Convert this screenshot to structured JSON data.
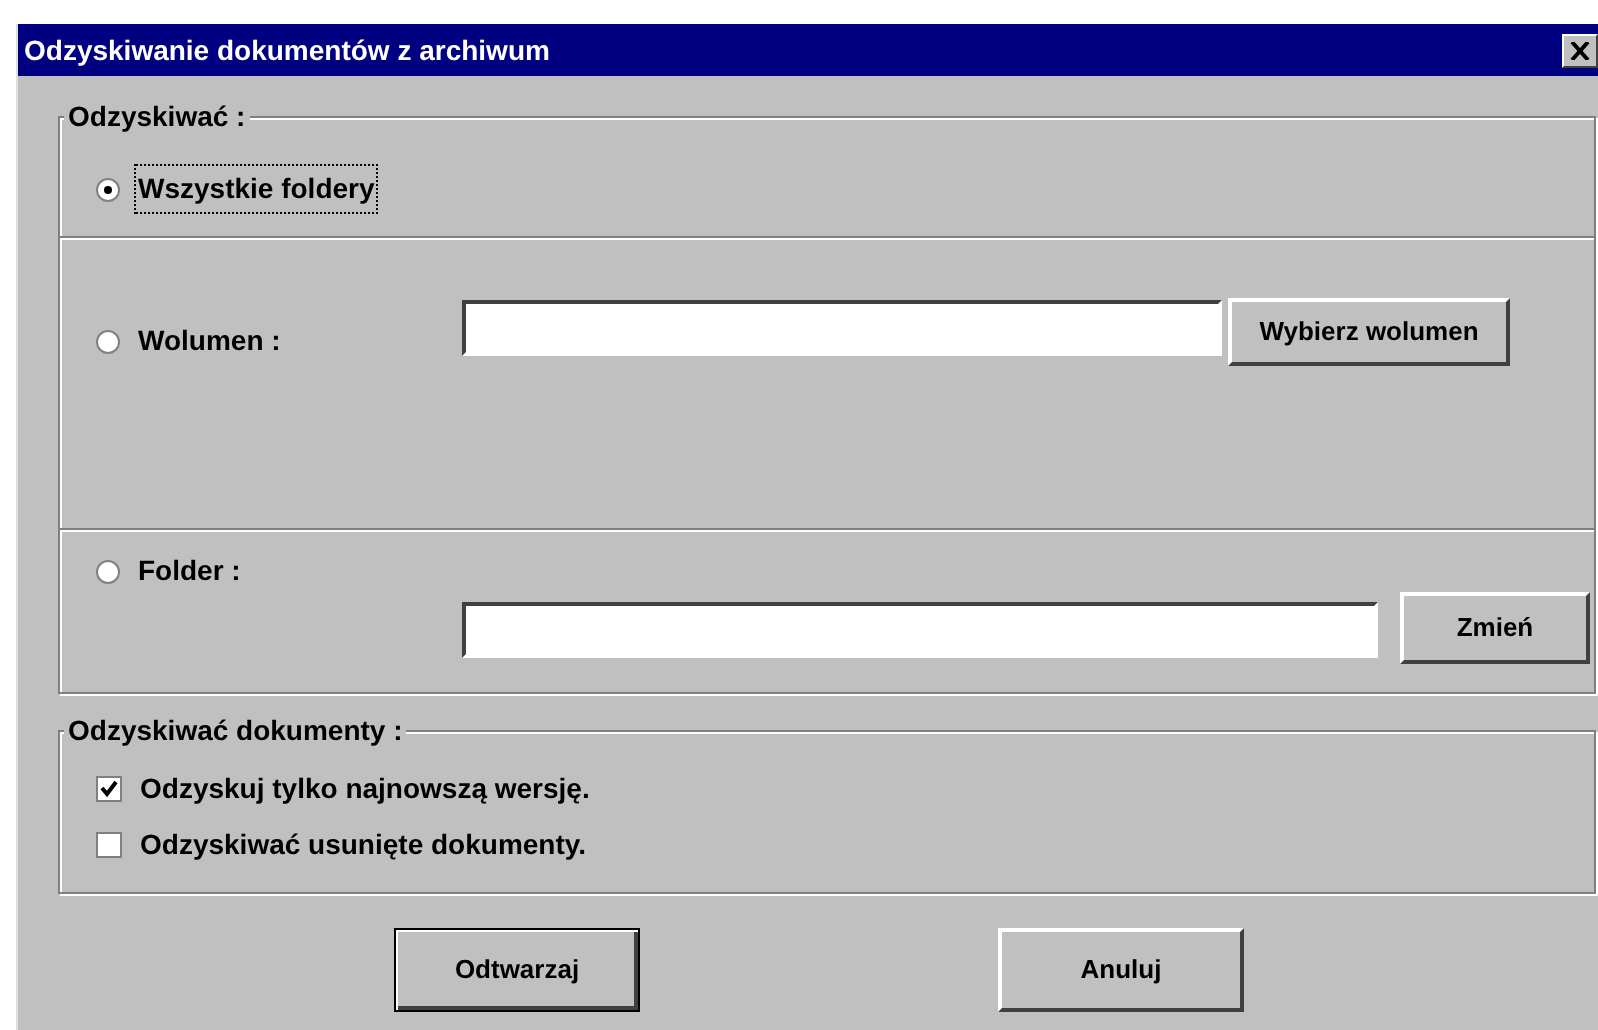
{
  "window": {
    "title": "Odzyskiwanie dokumentów z archiwum"
  },
  "scope_group": {
    "label": "Odzyskiwać :",
    "options": [
      {
        "label": "Wszystkie foldery",
        "selected": true
      },
      {
        "label": "Wolumen :",
        "selected": false,
        "button": "Wybierz wolumen"
      },
      {
        "label": "Folder :",
        "selected": false,
        "button": "Zmień"
      }
    ]
  },
  "documents_group": {
    "label": "Odzyskiwać dokumenty :",
    "options": [
      {
        "label": "Odzyskuj tylko najnowszą wersję.",
        "checked": true
      },
      {
        "label": "Odzyskiwać usunięte dokumenty.",
        "checked": false
      }
    ]
  },
  "buttons": [
    "Odtwarzaj",
    "Anuluj"
  ]
}
